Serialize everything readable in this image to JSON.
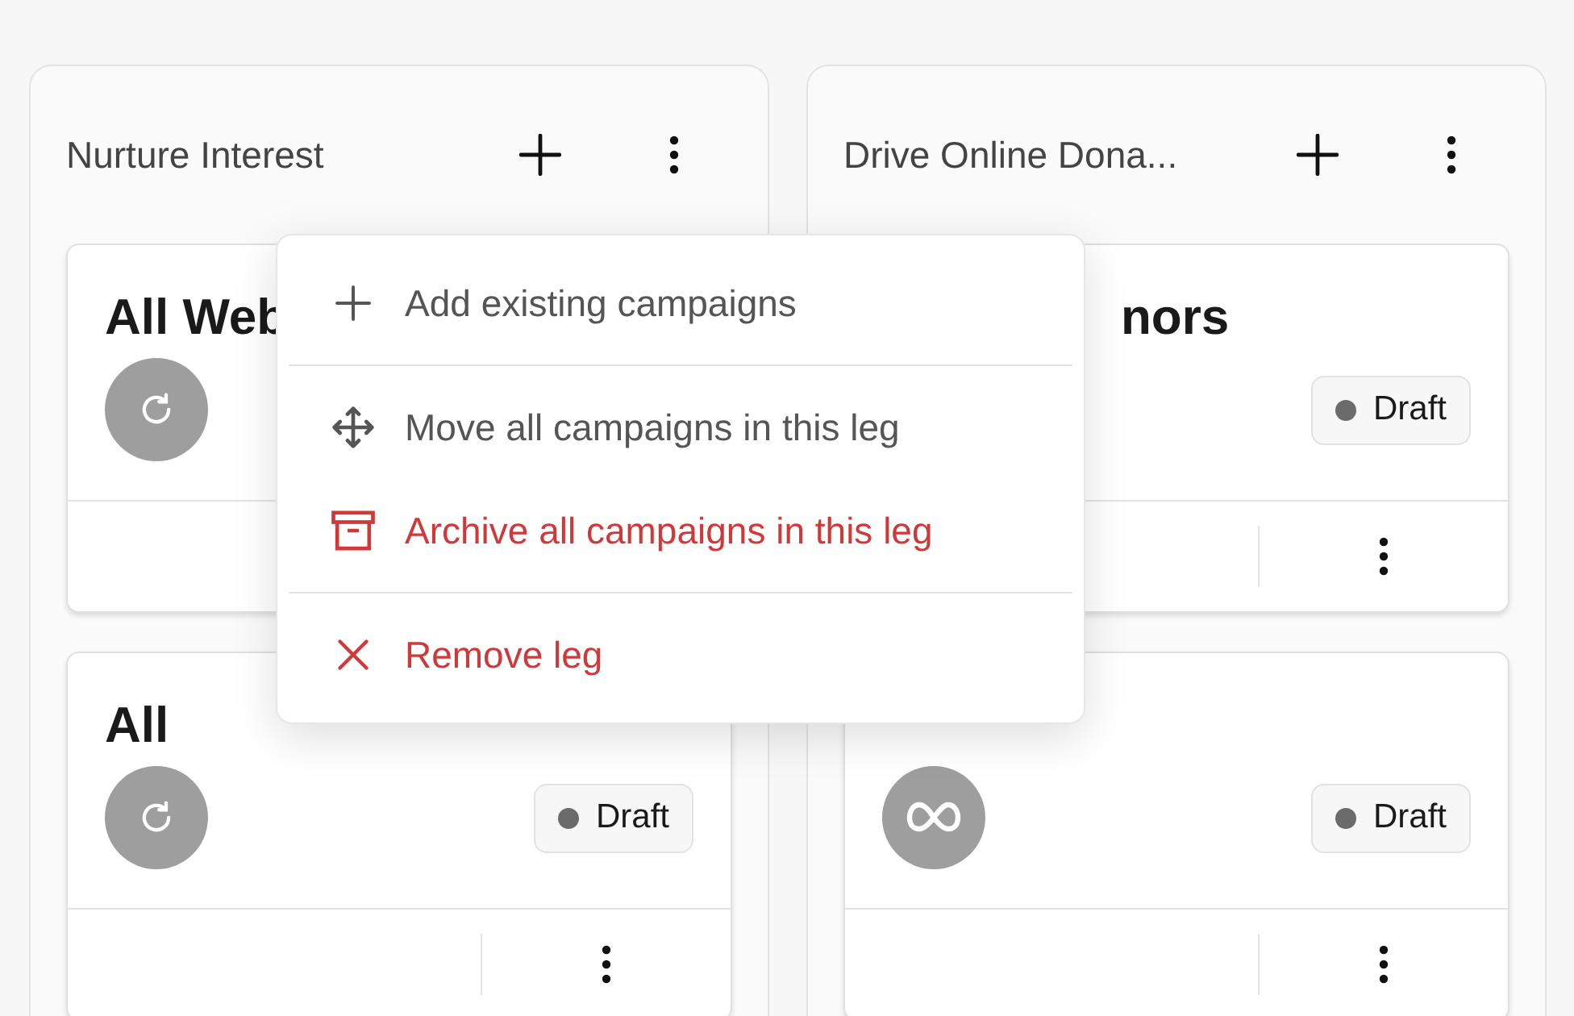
{
  "columns": [
    {
      "title": "Nurture Interest",
      "cards": [
        {
          "title": "All Web",
          "kind": "refresh"
        },
        {
          "title": "All",
          "kind": "refresh",
          "status": "Draft",
          "more_button": true
        }
      ]
    },
    {
      "title": "Drive Online Dona...",
      "cards": [
        {
          "title": "nors",
          "title_offset": true,
          "status": "Draft",
          "more_button": true
        },
        {
          "kind": "meta",
          "status": "Draft",
          "more_button": true
        }
      ]
    }
  ],
  "menu": {
    "groups": [
      [
        {
          "label": "Add existing campaigns",
          "kind": "add",
          "danger": false
        }
      ],
      [
        {
          "label": "Move all campaigns in this leg",
          "kind": "move",
          "danger": false
        },
        {
          "label": "Archive all campaigns in this leg",
          "kind": "archive",
          "danger": true
        }
      ],
      [
        {
          "label": "Remove leg",
          "kind": "remove",
          "danger": true
        }
      ]
    ]
  }
}
